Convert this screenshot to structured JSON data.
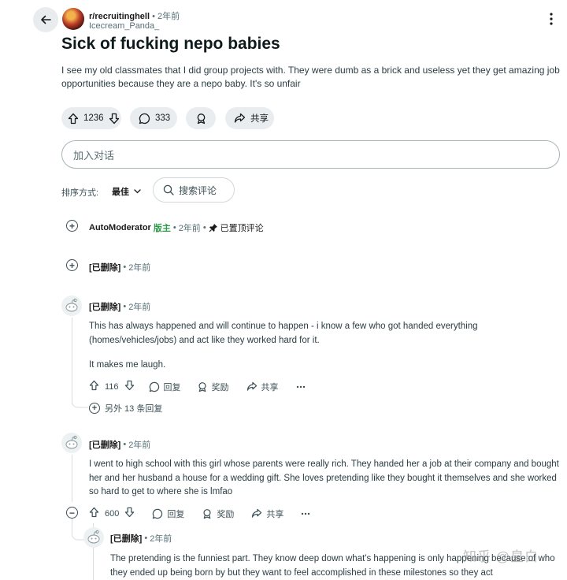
{
  "header": {
    "subreddit": "r/recruitinghell",
    "time": "2年前",
    "author": "Icecream_Panda_"
  },
  "post": {
    "title": "Sick of fucking nepo babies",
    "body": "I see my old classmates that I did group projects with. They were dumb as a brick and useless yet they get amazing job opportunities because they are a nepo baby. It's so unfair",
    "votes": "1236",
    "comments": "333",
    "share_label": "共享"
  },
  "composer": {
    "placeholder": "加入对话"
  },
  "sort": {
    "label": "排序方式:",
    "value": "最佳",
    "search_label": "搜索评论"
  },
  "comments": [
    {
      "author": "AutoModerator",
      "mod_tag": "版主",
      "time": "2年前",
      "pinned": "已置顶评论"
    },
    {
      "author": "[已删除]",
      "time": "2年前"
    },
    {
      "author": "[已删除]",
      "time": "2年前",
      "para1": "This has always happened and will continue to happen - i know a few who got handed everything (homes/vehicles/jobs) and act like they worked hard for it.",
      "para2": "It makes me laugh.",
      "votes": "116",
      "reply": "回复",
      "award": "奖励",
      "share": "共享",
      "more_replies": "另外 13 条回复"
    },
    {
      "author": "[已删除]",
      "time": "2年前",
      "text": "I went to high school with this girl whose parents were really rich. They handed her a job at their company and bought her and her husband a house for a wedding gift. She loves pretending like they bought it themselves and she worked so hard to get to where she is lmfao",
      "votes": "600",
      "reply": "回复",
      "award": "奖励",
      "share": "共享"
    },
    {
      "author": "[已删除]",
      "time": "2年前",
      "text": "The pretending is the funniest part. They know deep down what's happening is only happening because of who they ended up being born by but they want to feel accomplished in these milestones so they act"
    }
  ],
  "watermark": "知乎 @皇白",
  "icons": [
    "back-arrow-icon",
    "kebab-icon",
    "upvote-icon",
    "downvote-icon",
    "comment-icon",
    "award-icon",
    "share-icon",
    "search-icon",
    "chevron-down-icon",
    "expand-icon",
    "collapse-icon",
    "pin-icon",
    "snoo-avatar-icon",
    "more-icon"
  ]
}
